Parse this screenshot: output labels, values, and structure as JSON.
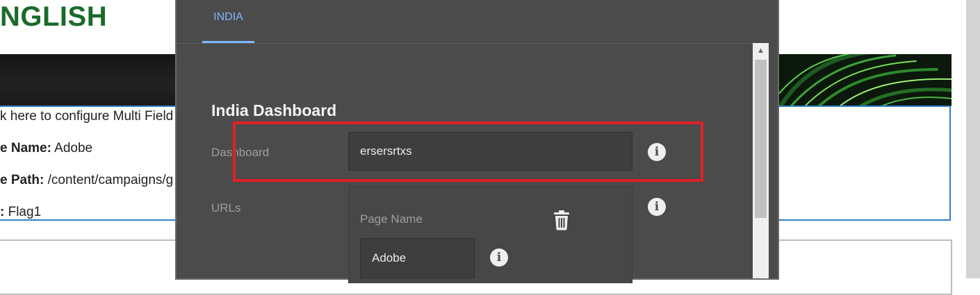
{
  "background_page": {
    "title": "NGLISH",
    "config_hint": "k here to configure Multi Field",
    "page_name_label": "e Name:",
    "page_name_value": "Adobe",
    "page_path_label": "e Path:",
    "page_path_value": "/content/campaigns/g",
    "flag_label": ":",
    "flag_value": "Flag1"
  },
  "dialog": {
    "tabs": [
      {
        "label": "INDIA",
        "active": true
      }
    ],
    "section_title": "India Dashboard",
    "dashboard": {
      "label": "Dashboard",
      "value": "ersersrtxs"
    },
    "urls": {
      "label": "URLs",
      "items": [
        {
          "page_name_label": "Page Name",
          "page_name_value": "Adobe"
        }
      ]
    }
  },
  "icons": {
    "info": "info-icon",
    "delete": "trash-icon",
    "scroll_up": "chevron-up-icon"
  },
  "colors": {
    "title_green": "#1a6b2b",
    "dialog_bg": "#4b4b4b",
    "tab_accent": "#7cb8ff",
    "highlight_red": "#e02026",
    "focus_border_blue": "#2f7fc6"
  }
}
